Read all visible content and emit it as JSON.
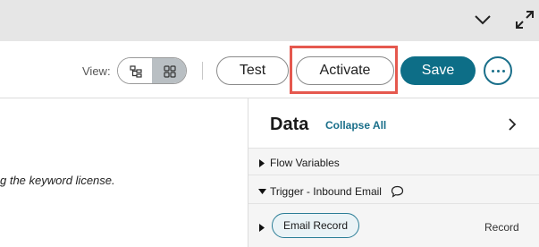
{
  "topbar": {
    "collapse_icon": "chevron-down-icon",
    "expand_icon": "expand-arrows-icon"
  },
  "toolbar": {
    "view_label": "View:",
    "view_options": [
      {
        "icon": "tree-view-icon",
        "selected": false
      },
      {
        "icon": "grid-view-icon",
        "selected": true
      }
    ],
    "test_label": "Test",
    "activate_label": "Activate",
    "save_label": "Save",
    "more_icon": "ellipsis-icon"
  },
  "canvas": {
    "text": "g the keyword license."
  },
  "data_panel": {
    "title": "Data",
    "collapse_all": "Collapse All",
    "items": [
      {
        "label": "Flow Variables",
        "expanded": false
      },
      {
        "label": "Trigger - Inbound Email",
        "expanded": true,
        "icon": "comment-icon"
      },
      {
        "label": "Email Record",
        "type": "Record",
        "expanded": false
      }
    ]
  },
  "colors": {
    "primary": "#0d6e87",
    "highlight": "#e5584e",
    "topbar": "#e6e6e6"
  }
}
